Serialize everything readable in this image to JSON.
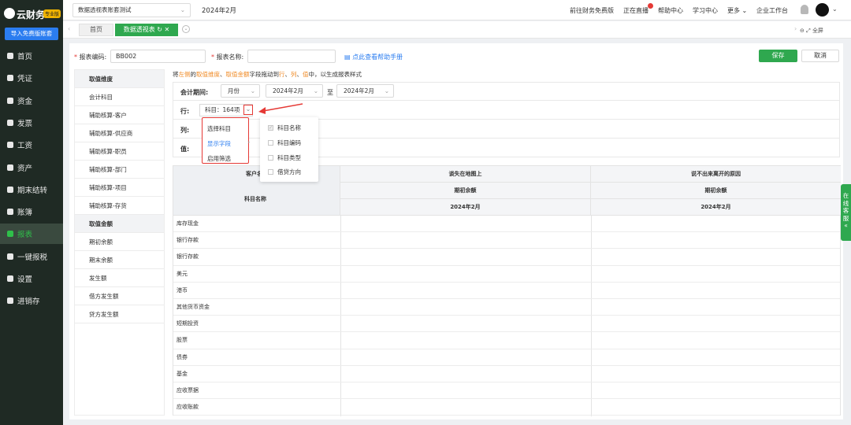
{
  "app": {
    "brand": "云财务",
    "brand_badge": "专业版",
    "import_button": "导入免费版账套"
  },
  "sidebar": {
    "items": [
      {
        "label": "首页",
        "icon": "home-icon"
      },
      {
        "label": "凭证",
        "icon": "voucher-icon"
      },
      {
        "label": "资金",
        "icon": "funds-icon"
      },
      {
        "label": "发票",
        "icon": "invoice-icon"
      },
      {
        "label": "工资",
        "icon": "salary-icon"
      },
      {
        "label": "资产",
        "icon": "asset-icon"
      },
      {
        "label": "期末结转",
        "icon": "closing-icon"
      },
      {
        "label": "账簿",
        "icon": "ledger-icon"
      },
      {
        "label": "报表",
        "icon": "report-icon",
        "active": true
      },
      {
        "label": "一键报税",
        "icon": "tax-icon"
      },
      {
        "label": "设置",
        "icon": "settings-icon"
      },
      {
        "label": "进销存",
        "icon": "inventory-icon"
      }
    ]
  },
  "topbar": {
    "account": "数据透视表账套测试",
    "period": "2024年2月",
    "links": [
      "前往财务免费版",
      "正在直播",
      "帮助中心",
      "学习中心",
      "更多",
      "企业工作台"
    ]
  },
  "tabs": {
    "home": "首页",
    "active": "数据透视表",
    "fullscreen": "全屏"
  },
  "form": {
    "code_label": "报表编码:",
    "code_value": "BB002",
    "name_label": "报表名称:",
    "name_value": "",
    "help_link": "点此查看帮助手册",
    "save": "保存",
    "cancel": "取消"
  },
  "left_list": {
    "dimension_header": "取值维度",
    "dimensions": [
      "会计科目",
      "辅助核算-客户",
      "辅助核算-供应商",
      "辅助核算-职员",
      "辅助核算-部门",
      "辅助核算-项目",
      "辅助核算-存货"
    ],
    "amount_header": "取值金额",
    "amounts": [
      "期初余额",
      "期末余额",
      "发生额",
      "借方发生额",
      "贷方发生额"
    ]
  },
  "hint": {
    "p1": "将",
    "left": "左侧",
    "p2": "的",
    "dim": "取值维度",
    "p3": "、",
    "amt": "取值金额",
    "p4": "字段拖动到",
    "row": "行",
    "p5": "、",
    "col": "列",
    "p6": "、",
    "val": "值",
    "p7": "中，以生成报表样式"
  },
  "config": {
    "period_label": "会计期间:",
    "period_type": "月份",
    "from": "2024年2月",
    "to_label": "至",
    "to": "2024年2月",
    "row_label": "行:",
    "row_chip": "科目：164项",
    "col_label": "列:",
    "val_label": "值:"
  },
  "menu": {
    "items": [
      "选择科目",
      "显示字段",
      "启用筛选"
    ]
  },
  "submenu": {
    "items": [
      {
        "label": "科目名称",
        "checked": true
      },
      {
        "label": "科目编码",
        "checked": false
      },
      {
        "label": "科目类型",
        "checked": false
      },
      {
        "label": "借贷方向",
        "checked": false
      }
    ]
  },
  "table": {
    "corner_top": "客户名",
    "corner_bottom": "科目名称",
    "groups": [
      "谈失在地图上",
      "说不出来离开的原因"
    ],
    "sub": "期初余额",
    "period": "2024年2月",
    "rows": [
      "库存现金",
      "银行存款",
      "银行存款",
      "美元",
      "港币",
      "其他货币资金",
      "短期投资",
      "股票",
      "债券",
      "基金",
      "应收票据",
      "应收账款"
    ]
  },
  "online_service": "在线客服"
}
